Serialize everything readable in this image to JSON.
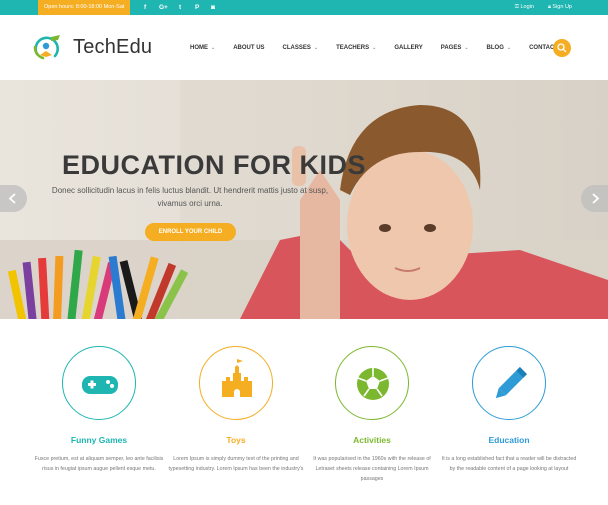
{
  "topbar": {
    "hours": "Open hours: 8:00-18:00 Mon-Sat",
    "social": [
      "facebook-icon",
      "google-plus-icon",
      "twitter-icon",
      "pinterest-icon",
      "instagram-icon"
    ],
    "social_glyphs": {
      "facebook": "f",
      "googleplus": "G+",
      "twitter": "t",
      "pinterest": "P",
      "instagram": "◙"
    },
    "login_label": "Login",
    "signup_label": "Sign Up",
    "colors": {
      "bar": "#1fb6b1",
      "hours_bg": "#f5ad22"
    }
  },
  "header": {
    "logo_text": "TechEdu",
    "nav": [
      {
        "label": "HOME",
        "dropdown": true
      },
      {
        "label": "ABOUT US",
        "dropdown": false
      },
      {
        "label": "CLASSES",
        "dropdown": true
      },
      {
        "label": "TEACHERS",
        "dropdown": true
      },
      {
        "label": "GALLERY",
        "dropdown": false
      },
      {
        "label": "PAGES",
        "dropdown": true
      },
      {
        "label": "BLOG",
        "dropdown": true
      },
      {
        "label": "CONTACT",
        "dropdown": false
      }
    ],
    "search_icon": "search-icon"
  },
  "hero": {
    "title": "EDUCATION FOR KIDS",
    "subtitle": "Donec sollicitudin lacus in felis luctus blandit. Ut hendrerit mattis justo at susp, vivamus orci urna.",
    "cta_label": "ENROLL YOUR CHILD",
    "prev_icon": "chevron-left-icon",
    "next_icon": "chevron-right-icon",
    "accent": "#f5ad22"
  },
  "features": [
    {
      "title": "Funny Games",
      "icon": "gamepad-icon",
      "color": "#1fb6b1",
      "text": "Fusce pretium, est at aliquam semper, leo ante facilisis risus in feugiat ipsum augue pellent esque metu."
    },
    {
      "title": "Toys",
      "icon": "castle-icon",
      "color": "#f5ad22",
      "text": "Lorem Ipsum is simply dummy text of the printing and typesetting industry. Lorem Ipsum has been the industry's"
    },
    {
      "title": "Activities",
      "icon": "soccer-ball-icon",
      "color": "#7cb82f",
      "text": "It was popularised in the 1960s with the release of Letraset sheets release containing Lorem Ipsum passages"
    },
    {
      "title": "Education",
      "icon": "pencil-icon",
      "color": "#2e9bd6",
      "text": "It is a long established fact that a reader will be distracted by the readable content of a page looking at layout"
    }
  ]
}
